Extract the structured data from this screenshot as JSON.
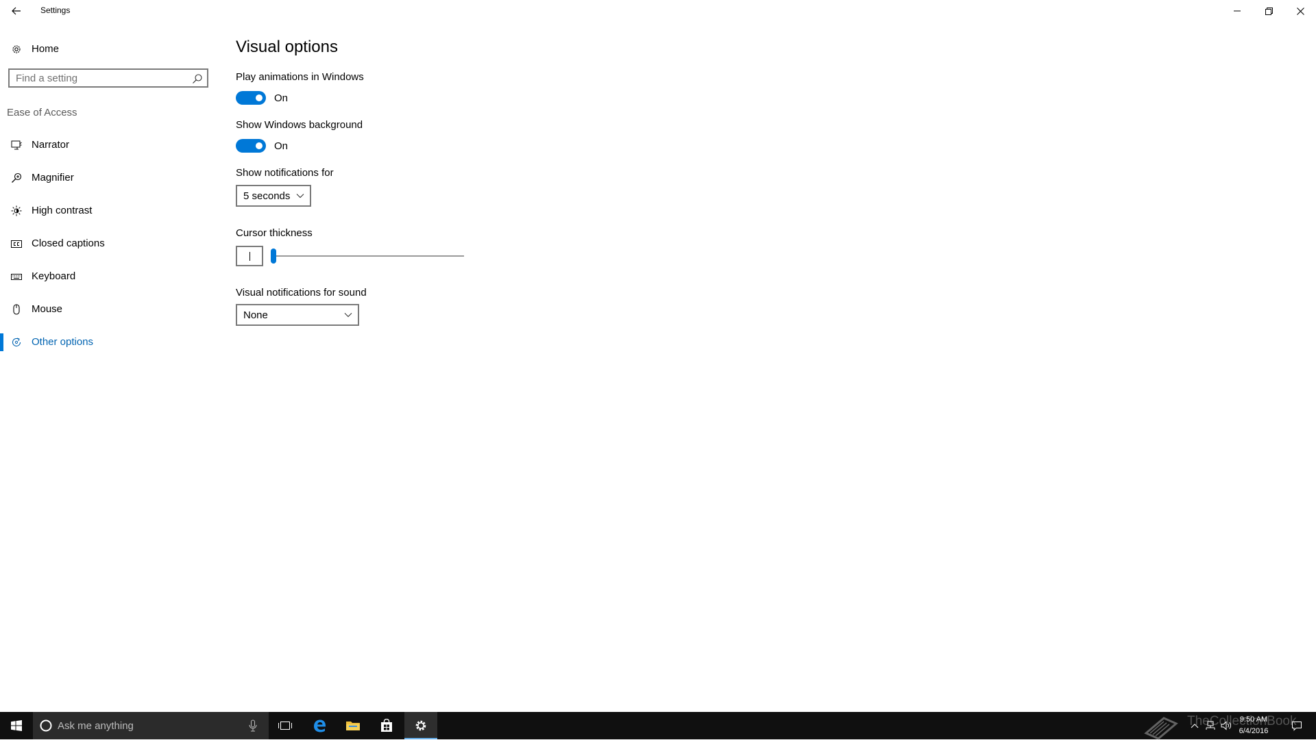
{
  "window": {
    "title": "Settings"
  },
  "sidebar": {
    "home_label": "Home",
    "search_placeholder": "Find a setting",
    "section_label": "Ease of Access",
    "items": [
      {
        "label": "Narrator",
        "icon": "narrator-icon"
      },
      {
        "label": "Magnifier",
        "icon": "magnifier-icon"
      },
      {
        "label": "High contrast",
        "icon": "high-contrast-icon"
      },
      {
        "label": "Closed captions",
        "icon": "closed-captions-icon"
      },
      {
        "label": "Keyboard",
        "icon": "keyboard-icon"
      },
      {
        "label": "Mouse",
        "icon": "mouse-icon"
      },
      {
        "label": "Other options",
        "icon": "other-options-icon",
        "active": true
      }
    ]
  },
  "main": {
    "title": "Visual options",
    "play_animations": {
      "label": "Play animations in Windows",
      "state": "On"
    },
    "show_background": {
      "label": "Show Windows background",
      "state": "On"
    },
    "notifications": {
      "label": "Show notifications for",
      "value": "5 seconds"
    },
    "cursor_thickness": {
      "label": "Cursor thickness",
      "value": 1,
      "min": 1,
      "max": 20
    },
    "visual_notifications": {
      "label": "Visual notifications for sound",
      "value": "None"
    }
  },
  "taskbar": {
    "search_placeholder": "Ask me anything",
    "clock_time": "9:50 AM",
    "clock_date": "6/4/2016",
    "watermark": "TheCollectionBook"
  },
  "colors": {
    "accent": "#0078d7",
    "active_text": "#0063b1",
    "taskbar": "#101010"
  }
}
